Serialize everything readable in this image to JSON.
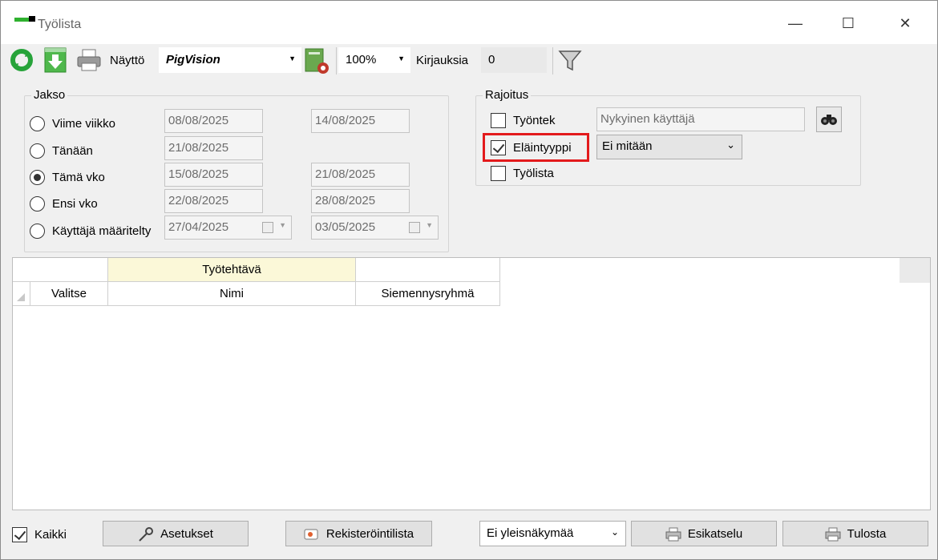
{
  "window": {
    "title": "Työlista",
    "minimize_glyph": "—",
    "maximize_glyph": "☐",
    "close_glyph": "✕"
  },
  "toolbar": {
    "refresh_icon": "refresh-icon",
    "download_icon": "download-icon",
    "print_icon": "printer-icon",
    "display_label": "Näyttö",
    "display_value": "PigVision",
    "zoom_value": "100%",
    "entries_label": "Kirjauksia",
    "entries_value": "0",
    "filter_icon": "funnel-icon"
  },
  "period": {
    "title": "Jakso",
    "options": [
      {
        "label": "Viime viikko",
        "from": "08/08/2025",
        "to": "14/08/2025",
        "checked": false
      },
      {
        "label": "Tänään",
        "from": "21/08/2025",
        "to": "",
        "checked": false
      },
      {
        "label": "Tämä vko",
        "from": "15/08/2025",
        "to": "21/08/2025",
        "checked": true
      },
      {
        "label": "Ensi vko",
        "from": "22/08/2025",
        "to": "28/08/2025",
        "checked": false
      },
      {
        "label": "Käyttäjä määritelty",
        "from": "27/04/2025",
        "to": "03/05/2025",
        "checked": false
      }
    ]
  },
  "restriction": {
    "title": "Rajoitus",
    "employee_label": "Työntek",
    "employee_placeholder": "Nykyinen käyttäjä",
    "animal_type_label": "Eläintyyppi",
    "animal_type_value": "Ei mitään",
    "worklist_label": "Työlista"
  },
  "grid": {
    "group_header": "Työtehtävä",
    "columns": [
      "Valitse",
      "Nimi",
      "Siemennysryhmä"
    ]
  },
  "bottom": {
    "all_label": "Kaikki",
    "settings_label": "Asetukset",
    "registration_label": "Rekisteröintilista",
    "view_select_value": "Ei yleisnäkymää",
    "preview_label": "Esikatselu",
    "print_label": "Tulosta"
  },
  "colors": {
    "highlight": "#e31a1c",
    "header_yellow": "#fbf8d8",
    "window_bg": "#f0f0f0"
  }
}
